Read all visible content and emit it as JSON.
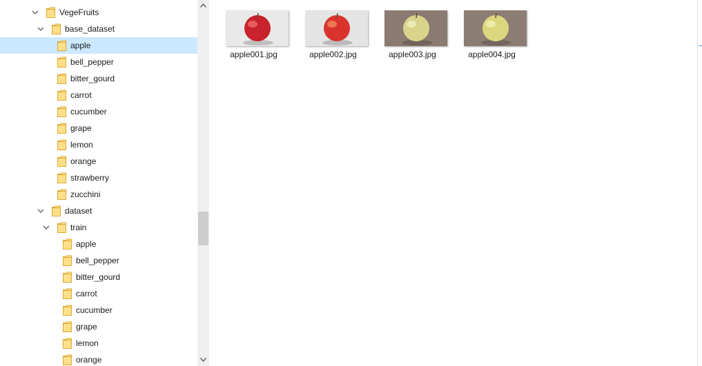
{
  "tree": [
    {
      "label": "VegeFruits",
      "depth": 0,
      "expanded": true,
      "selected": false
    },
    {
      "label": "base_dataset",
      "depth": 1,
      "expanded": true,
      "selected": false
    },
    {
      "label": "apple",
      "depth": 2,
      "expanded": false,
      "selected": true
    },
    {
      "label": "bell_pepper",
      "depth": 2,
      "expanded": false,
      "selected": false
    },
    {
      "label": "bitter_gourd",
      "depth": 2,
      "expanded": false,
      "selected": false
    },
    {
      "label": "carrot",
      "depth": 2,
      "expanded": false,
      "selected": false
    },
    {
      "label": "cucumber",
      "depth": 2,
      "expanded": false,
      "selected": false
    },
    {
      "label": "grape",
      "depth": 2,
      "expanded": false,
      "selected": false
    },
    {
      "label": "lemon",
      "depth": 2,
      "expanded": false,
      "selected": false
    },
    {
      "label": "orange",
      "depth": 2,
      "expanded": false,
      "selected": false
    },
    {
      "label": "strawberry",
      "depth": 2,
      "expanded": false,
      "selected": false
    },
    {
      "label": "zucchini",
      "depth": 2,
      "expanded": false,
      "selected": false
    },
    {
      "label": "dataset",
      "depth": 1,
      "expanded": true,
      "selected": false
    },
    {
      "label": "train",
      "depth": 2,
      "expanded": true,
      "selected": false
    },
    {
      "label": "apple",
      "depth": 3,
      "expanded": false,
      "selected": false
    },
    {
      "label": "bell_pepper",
      "depth": 3,
      "expanded": false,
      "selected": false
    },
    {
      "label": "bitter_gourd",
      "depth": 3,
      "expanded": false,
      "selected": false
    },
    {
      "label": "carrot",
      "depth": 3,
      "expanded": false,
      "selected": false
    },
    {
      "label": "cucumber",
      "depth": 3,
      "expanded": false,
      "selected": false
    },
    {
      "label": "grape",
      "depth": 3,
      "expanded": false,
      "selected": false
    },
    {
      "label": "lemon",
      "depth": 3,
      "expanded": false,
      "selected": false
    },
    {
      "label": "orange",
      "depth": 3,
      "expanded": false,
      "selected": false
    }
  ],
  "files": [
    {
      "name": "apple001.jpg",
      "thumb": {
        "bg": "#e9e9e9",
        "fruit": "#c8232c",
        "highlight": "#ef6a6a",
        "stem": "#6b4a2a"
      }
    },
    {
      "name": "apple002.jpg",
      "thumb": {
        "bg": "#e4e4e4",
        "fruit": "#d9332e",
        "highlight": "#f08a5a",
        "stem": "#6b4a2a"
      }
    },
    {
      "name": "apple003.jpg",
      "thumb": {
        "bg": "#8a7a72",
        "fruit": "#d8d48a",
        "highlight": "#f1efbf",
        "stem": "#5a4a30"
      }
    },
    {
      "name": "apple004.jpg",
      "thumb": {
        "bg": "#8c7d74",
        "fruit": "#dcd77e",
        "highlight": "#f3f0b8",
        "stem": "#5a4a30"
      }
    }
  ],
  "colors": {
    "selection": "#cce8ff",
    "folder_fill": "#ffe08a",
    "folder_edge": "#d9a936",
    "chevron": "#5a5a5a"
  },
  "icons": {
    "expanded": "chevron-down-icon",
    "folder": "folder-icon",
    "scroll_up": "scroll-up-arrow-icon",
    "scroll_down": "scroll-down-arrow-icon"
  }
}
